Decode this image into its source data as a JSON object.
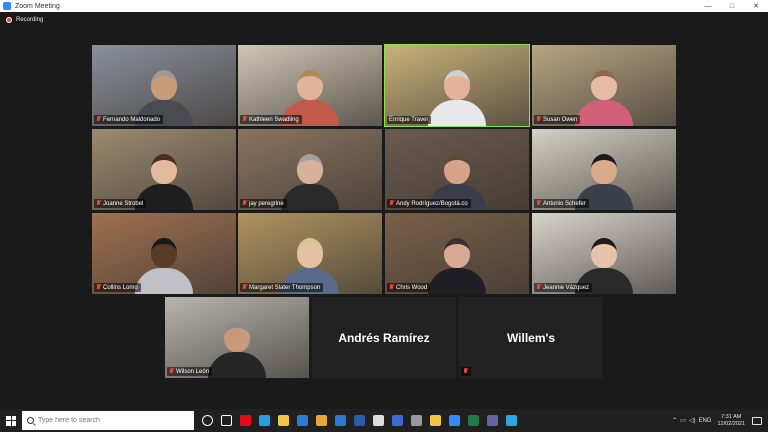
{
  "window": {
    "title": "Zoom Meeting",
    "controls": [
      "—",
      "□",
      "✕"
    ]
  },
  "meeting": {
    "recording_label": "Recording",
    "participants": [
      {
        "name": "Fernando Maldonado",
        "muted": true,
        "bg": "#8a8f99",
        "shirt": "#4a4a52",
        "skin": "#c89b7b",
        "hair": "#9a9a9a"
      },
      {
        "name": "Kathleen Swadling",
        "muted": true,
        "bg": "#cfc6b6",
        "shirt": "#c25a4a",
        "skin": "#e0b49a",
        "hair": "#b08a5a"
      },
      {
        "name": "Enrique Traver",
        "muted": false,
        "active": true,
        "bg": "#c9b27a",
        "shirt": "#e8e8ea",
        "skin": "#e2b39a",
        "hair": "#cfcfcf"
      },
      {
        "name": "Susan Owen",
        "muted": true,
        "bg": "#b7a583",
        "shirt": "#d0607a",
        "skin": "#e6bca4",
        "hair": "#8a6a4a"
      },
      {
        "name": "Joanne Strobel",
        "muted": true,
        "bg": "#9c8a70",
        "shirt": "#1e1e1e",
        "skin": "#e3b89e",
        "hair": "#4a2e22"
      },
      {
        "name": "jay peregrine",
        "muted": true,
        "bg": "#8a7460",
        "shirt": "#2a2a2a",
        "skin": "#d9b09a",
        "hair": "#a0a0a0"
      },
      {
        "name": "Andy Rodríguez/Bogotá.co",
        "muted": true,
        "bg": "#6b5a4e",
        "shirt": "#3a3d4a",
        "skin": "#d6a48a",
        "hair": "#5a4a3a"
      },
      {
        "name": "Antonio Schefer",
        "muted": true,
        "bg": "#d4d0c4",
        "shirt": "#3a3f4a",
        "skin": "#d9aa8c",
        "hair": "#1a1a22"
      },
      {
        "name": "Collins Lomo",
        "muted": true,
        "bg": "#a07050",
        "shirt": "#c0c0c6",
        "skin": "#5a3a28",
        "hair": "#1a1a1a"
      },
      {
        "name": "Margaret Slater Thompson",
        "muted": true,
        "bg": "#b09460",
        "shirt": "#5a6a8a",
        "skin": "#e6c0a4",
        "hair": "#d8c490"
      },
      {
        "name": "Chris Wood",
        "muted": true,
        "bg": "#7a6048",
        "shirt": "#1e1e24",
        "skin": "#d8a890",
        "hair": "#3a3030"
      },
      {
        "name": "Jeannie Vázquez",
        "muted": true,
        "bg": "#d8d4cc",
        "shirt": "#2a2a2a",
        "skin": "#e6c2a8",
        "hair": "#1e1a1a"
      },
      {
        "name": "Wilson León",
        "muted": true,
        "bg": "#b8b4ae",
        "shirt": "#262626",
        "skin": "#c79a7c",
        "hair": "#8a8a8a"
      }
    ],
    "name_cards": [
      {
        "name": "Andrés Ramírez",
        "muted": false
      },
      {
        "name": "Willem's",
        "muted": true
      }
    ]
  },
  "taskbar": {
    "search_placeholder": "Type here to search",
    "apps": [
      {
        "icon": "cortana-icon",
        "color": "#ffffff"
      },
      {
        "icon": "task-view-icon",
        "color": "#ffffff"
      },
      {
        "icon": "netflix-icon",
        "color": "#e50914"
      },
      {
        "icon": "edge-icon",
        "color": "#1fa0e0"
      },
      {
        "icon": "store-icon",
        "color": "#f2c744"
      },
      {
        "icon": "mail-icon",
        "color": "#2b7bd6"
      },
      {
        "icon": "chrome-icon",
        "color": "#e4a63a"
      },
      {
        "icon": "outlook-icon",
        "color": "#2a7bd3"
      },
      {
        "icon": "word-icon",
        "color": "#2b5aa8"
      },
      {
        "icon": "settings-icon",
        "color": "#dddddd"
      },
      {
        "icon": "photos-icon",
        "color": "#3a6ad0"
      },
      {
        "icon": "calculator-icon",
        "color": "#9a9a9a"
      },
      {
        "icon": "file-explorer-icon",
        "color": "#f2c744"
      },
      {
        "icon": "zoom-icon",
        "color": "#2d8cff"
      },
      {
        "icon": "excel-icon",
        "color": "#1f7a44"
      },
      {
        "icon": "teams-icon",
        "color": "#6264a7"
      },
      {
        "icon": "skype-icon",
        "color": "#2aa6e0"
      }
    ],
    "tray": {
      "language": "ENG",
      "time": "7:31 AM",
      "date": "12/02/2021"
    }
  }
}
